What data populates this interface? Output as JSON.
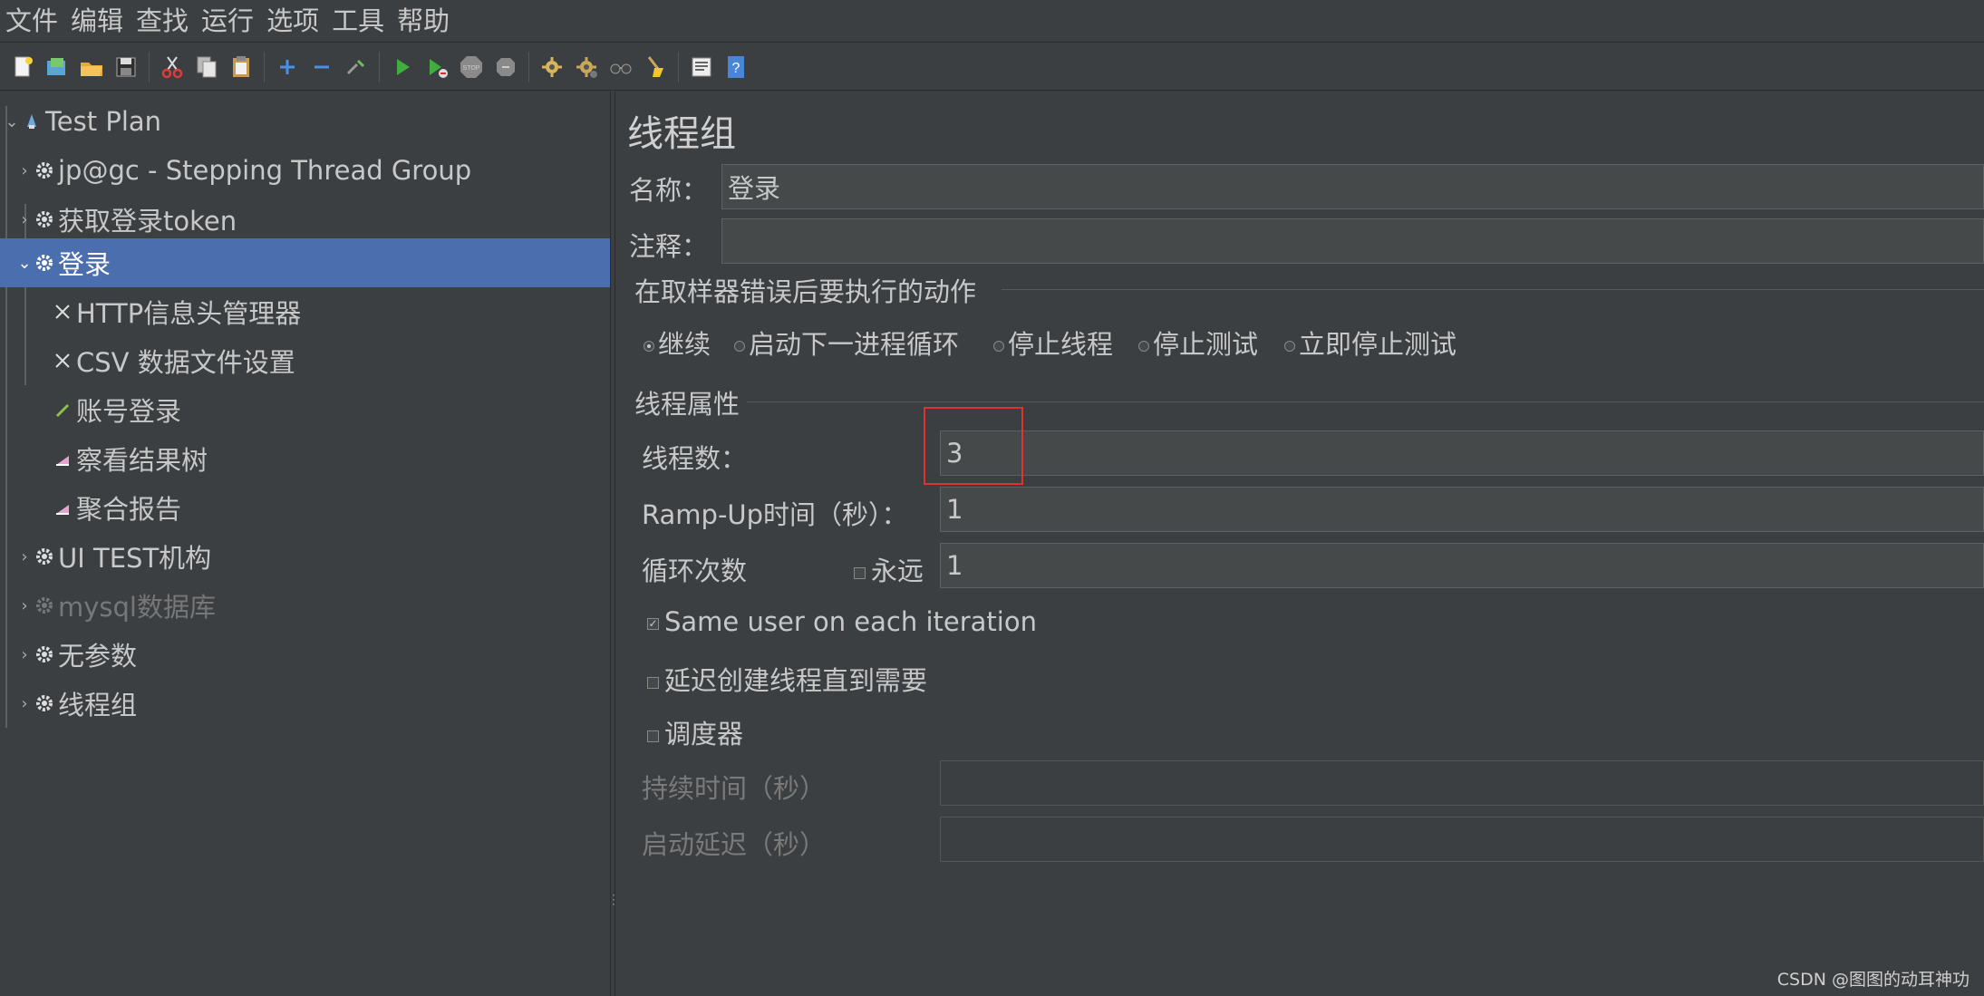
{
  "menu": [
    "文件",
    "编辑",
    "查找",
    "运行",
    "选项",
    "工具",
    "帮助"
  ],
  "toolbar": [
    {
      "name": "new-icon"
    },
    {
      "name": "templates-icon"
    },
    {
      "name": "open-icon"
    },
    {
      "name": "save-icon"
    },
    {
      "sep": true
    },
    {
      "name": "cut-icon"
    },
    {
      "name": "copy-icon"
    },
    {
      "name": "paste-icon"
    },
    {
      "sep": true
    },
    {
      "name": "expand-icon"
    },
    {
      "name": "collapse-icon"
    },
    {
      "name": "toggle-icon"
    },
    {
      "sep": true
    },
    {
      "name": "start-icon"
    },
    {
      "name": "start-no-pause-icon"
    },
    {
      "name": "stop-icon"
    },
    {
      "name": "shutdown-icon"
    },
    {
      "sep": true
    },
    {
      "name": "remote-start-icon"
    },
    {
      "name": "remote-stop-icon"
    },
    {
      "name": "clear-icon"
    },
    {
      "name": "clear-all-icon"
    },
    {
      "sep": true
    },
    {
      "name": "function-helper-icon"
    },
    {
      "name": "help-icon"
    }
  ],
  "tree": {
    "items": [
      {
        "label": "Test Plan",
        "icon": "test-plan-icon",
        "chevron": "⌄",
        "state": "normal"
      },
      {
        "label": "jp@gc - Stepping Thread Group",
        "icon": "gear-icon",
        "chevron": "›",
        "state": "normal"
      },
      {
        "label": "获取登录token",
        "icon": "gear-icon",
        "chevron": "›",
        "state": "normal"
      },
      {
        "label": "登录",
        "icon": "gear-icon",
        "chevron": "⌄",
        "state": "selected"
      },
      {
        "label": "HTTP信息头管理器",
        "icon": "wrench-icon",
        "chevron": "",
        "state": "normal"
      },
      {
        "label": "CSV 数据文件设置",
        "icon": "wrench-icon",
        "chevron": "",
        "state": "normal"
      },
      {
        "label": "账号登录",
        "icon": "pipette-icon",
        "chevron": "",
        "state": "normal"
      },
      {
        "label": "察看结果树",
        "icon": "chart-icon",
        "chevron": "",
        "state": "normal"
      },
      {
        "label": "聚合报告",
        "icon": "chart-icon",
        "chevron": "",
        "state": "normal"
      },
      {
        "label": "UI TEST机构",
        "icon": "gear-icon",
        "chevron": "›",
        "state": "normal"
      },
      {
        "label": "mysql数据库",
        "icon": "gear-icon",
        "chevron": "›",
        "state": "disabled"
      },
      {
        "label": "无参数",
        "icon": "gear-icon",
        "chevron": "›",
        "state": "normal"
      },
      {
        "label": "线程组",
        "icon": "gear-icon",
        "chevron": "›",
        "state": "normal"
      }
    ]
  },
  "panel": {
    "title": "线程组",
    "name_label": "名称：",
    "name_value": "登录",
    "comment_label": "注释：",
    "comment_value": "",
    "error_action": {
      "title": "在取样器错误后要执行的动作",
      "options": [
        "继续",
        "启动下一进程循环",
        "停止线程",
        "停止测试",
        "立即停止测试"
      ],
      "selected": "继续"
    },
    "thread_props": {
      "title": "线程属性",
      "threads_label": "线程数：",
      "threads_value": "3",
      "rampup_label": "Ramp-Up时间（秒）：",
      "rampup_value": "1",
      "loop_label": "循环次数",
      "forever_label": "永远",
      "forever_checked": false,
      "loop_value": "1",
      "same_user_label": "Same user on each iteration",
      "same_user_checked": true,
      "delay_label": "延迟创建线程直到需要",
      "delay_checked": false,
      "scheduler_label": "调度器",
      "scheduler_checked": false,
      "duration_label": "持续时间（秒）",
      "duration_value": "",
      "startup_delay_label": "启动延迟（秒）",
      "startup_delay_value": ""
    }
  },
  "colors": {
    "background": "#3c3f41",
    "selection": "#4b6eaf",
    "field": "#45494a",
    "highlight": "#e0322e"
  },
  "watermark": "CSDN @图图的动耳神功"
}
